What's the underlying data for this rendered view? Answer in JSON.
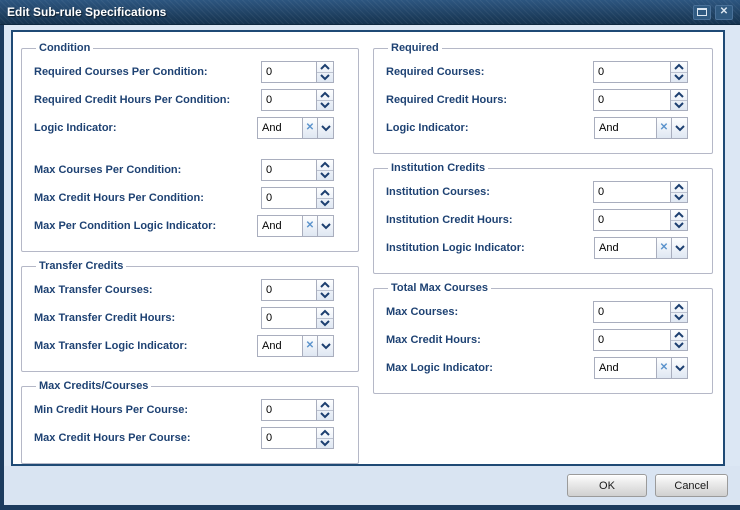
{
  "window": {
    "title": "Edit Sub-rule Specifications"
  },
  "icons": {
    "close": "✕",
    "clear": "✕"
  },
  "colors": {
    "titlebar_top": "#2d5680",
    "titlebar_bottom": "#16334f",
    "window_frame": "#1c3b5e",
    "body_background": "#dce7f4",
    "panel_border": "#1f4a75",
    "fieldset_border": "#b5b8c7",
    "label_text": "#1e4273",
    "input_border": "#a9aebe",
    "spinner_chevron": "#1c3f70",
    "clear_icon": "#5b93cc",
    "footer_background": "#d9e4f2"
  },
  "panel": {
    "columns": [
      {
        "groups": [
          {
            "title": "Condition",
            "fields": [
              {
                "label": "Required Courses Per Condition:",
                "type": "spinner",
                "value": "0"
              },
              {
                "label": "Required Credit Hours Per Condition:",
                "type": "spinner",
                "value": "0"
              },
              {
                "label": "Logic Indicator:",
                "type": "combo",
                "value": "And"
              },
              {
                "label": "Max Courses Per Condition:",
                "type": "spinner",
                "value": "0",
                "gap_before": true
              },
              {
                "label": "Max Credit Hours Per Condition:",
                "type": "spinner",
                "value": "0"
              },
              {
                "label": "Max Per Condition Logic Indicator:",
                "type": "combo",
                "value": "And"
              }
            ]
          },
          {
            "title": "Transfer Credits",
            "fields": [
              {
                "label": "Max Transfer Courses:",
                "type": "spinner",
                "value": "0"
              },
              {
                "label": "Max Transfer Credit Hours:",
                "type": "spinner",
                "value": "0"
              },
              {
                "label": "Max Transfer Logic Indicator:",
                "type": "combo",
                "value": "And"
              }
            ]
          },
          {
            "title": "Max Credits/Courses",
            "fields": [
              {
                "label": "Min Credit Hours Per Course:",
                "type": "spinner",
                "value": "0"
              },
              {
                "label": "Max Credit Hours Per Course:",
                "type": "spinner",
                "value": "0"
              }
            ]
          }
        ]
      },
      {
        "groups": [
          {
            "title": "Required",
            "fields": [
              {
                "label": "Required Courses:",
                "type": "spinner",
                "value": "0"
              },
              {
                "label": "Required Credit Hours:",
                "type": "spinner",
                "value": "0"
              },
              {
                "label": "Logic Indicator:",
                "type": "combo",
                "value": "And"
              }
            ]
          },
          {
            "title": "Institution Credits",
            "fields": [
              {
                "label": "Institution Courses:",
                "type": "spinner",
                "value": "0"
              },
              {
                "label": "Institution Credit Hours:",
                "type": "spinner",
                "value": "0"
              },
              {
                "label": "Institution Logic Indicator:",
                "type": "combo",
                "value": "And"
              }
            ]
          },
          {
            "title": "Total Max Courses",
            "fields": [
              {
                "label": "Max Courses:",
                "type": "spinner",
                "value": "0"
              },
              {
                "label": "Max Credit Hours:",
                "type": "spinner",
                "value": "0"
              },
              {
                "label": "Max Logic Indicator:",
                "type": "combo",
                "value": "And"
              }
            ]
          }
        ]
      }
    ]
  },
  "footer": {
    "ok_label": "OK",
    "cancel_label": "Cancel"
  }
}
